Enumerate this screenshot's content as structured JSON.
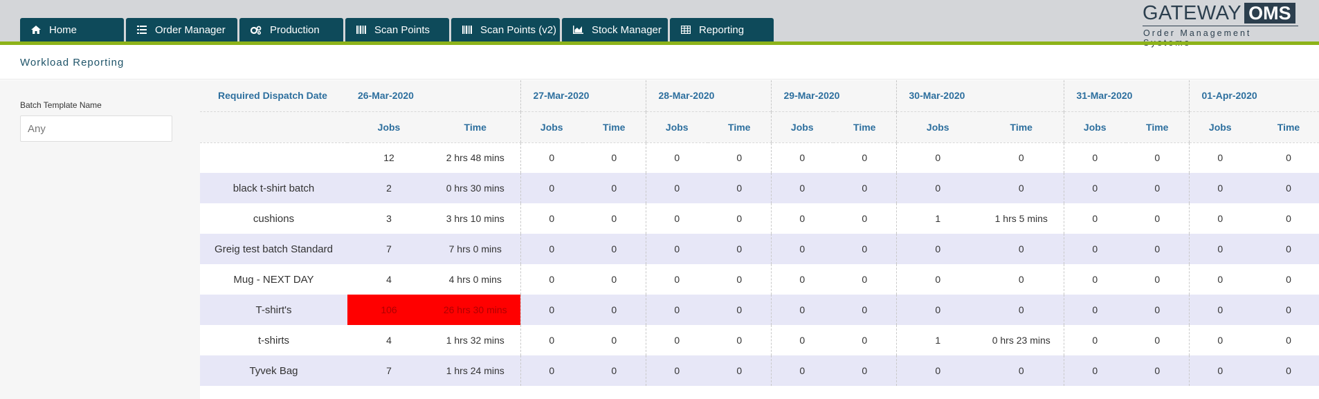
{
  "nav": {
    "tabs": [
      {
        "label": "Home",
        "icon": "home-icon"
      },
      {
        "label": "Order Manager",
        "icon": "list-icon"
      },
      {
        "label": "Production",
        "icon": "cogs-icon"
      },
      {
        "label": "Scan Points",
        "icon": "barcode-icon"
      },
      {
        "label": "Scan Points (v2)",
        "icon": "barcode-icon"
      },
      {
        "label": "Stock Manager",
        "icon": "chart-icon"
      },
      {
        "label": "Reporting",
        "icon": "table-icon"
      }
    ],
    "accent_color": "#8db31a",
    "tab_color": "#0e4a5a"
  },
  "logo": {
    "word": "GATEWAY",
    "badge": "OMS",
    "tagline": "Order Management Systems"
  },
  "page": {
    "title": "Workload Reporting"
  },
  "filter": {
    "label": "Batch Template Name",
    "placeholder": "Any"
  },
  "table": {
    "row_header": "Required Dispatch Date",
    "dates": [
      "26-Mar-2020",
      "27-Mar-2020",
      "28-Mar-2020",
      "29-Mar-2020",
      "30-Mar-2020",
      "31-Mar-2020",
      "01-Apr-2020"
    ],
    "col_jobs": "Jobs",
    "col_time": "Time",
    "highlight_color": "#ff0000",
    "rows": [
      {
        "name": "",
        "cells": [
          [
            "12",
            "2 hrs 48 mins"
          ],
          [
            "0",
            "0"
          ],
          [
            "0",
            "0"
          ],
          [
            "0",
            "0"
          ],
          [
            "0",
            "0"
          ],
          [
            "0",
            "0"
          ],
          [
            "0",
            "0"
          ]
        ]
      },
      {
        "name": "black t-shirt batch",
        "cells": [
          [
            "2",
            "0 hrs 30 mins"
          ],
          [
            "0",
            "0"
          ],
          [
            "0",
            "0"
          ],
          [
            "0",
            "0"
          ],
          [
            "0",
            "0"
          ],
          [
            "0",
            "0"
          ],
          [
            "0",
            "0"
          ]
        ]
      },
      {
        "name": "cushions",
        "cells": [
          [
            "3",
            "3 hrs 10 mins"
          ],
          [
            "0",
            "0"
          ],
          [
            "0",
            "0"
          ],
          [
            "0",
            "0"
          ],
          [
            "1",
            "1 hrs 5 mins"
          ],
          [
            "0",
            "0"
          ],
          [
            "0",
            "0"
          ]
        ]
      },
      {
        "name": "Greig test batch Standard",
        "cells": [
          [
            "7",
            "7 hrs 0 mins"
          ],
          [
            "0",
            "0"
          ],
          [
            "0",
            "0"
          ],
          [
            "0",
            "0"
          ],
          [
            "0",
            "0"
          ],
          [
            "0",
            "0"
          ],
          [
            "0",
            "0"
          ]
        ]
      },
      {
        "name": "Mug - NEXT DAY",
        "cells": [
          [
            "4",
            "4 hrs 0 mins"
          ],
          [
            "0",
            "0"
          ],
          [
            "0",
            "0"
          ],
          [
            "0",
            "0"
          ],
          [
            "0",
            "0"
          ],
          [
            "0",
            "0"
          ],
          [
            "0",
            "0"
          ]
        ]
      },
      {
        "name": "T-shirt's",
        "highlight_first": true,
        "cells": [
          [
            "106",
            "26 hrs 30 mins"
          ],
          [
            "0",
            "0"
          ],
          [
            "0",
            "0"
          ],
          [
            "0",
            "0"
          ],
          [
            "0",
            "0"
          ],
          [
            "0",
            "0"
          ],
          [
            "0",
            "0"
          ]
        ]
      },
      {
        "name": "t-shirts",
        "cells": [
          [
            "4",
            "1 hrs 32 mins"
          ],
          [
            "0",
            "0"
          ],
          [
            "0",
            "0"
          ],
          [
            "0",
            "0"
          ],
          [
            "1",
            "0 hrs 23 mins"
          ],
          [
            "0",
            "0"
          ],
          [
            "0",
            "0"
          ]
        ]
      },
      {
        "name": "Tyvek Bag",
        "cells": [
          [
            "7",
            "1 hrs 24 mins"
          ],
          [
            "0",
            "0"
          ],
          [
            "0",
            "0"
          ],
          [
            "0",
            "0"
          ],
          [
            "0",
            "0"
          ],
          [
            "0",
            "0"
          ],
          [
            "0",
            "0"
          ]
        ]
      }
    ]
  }
}
